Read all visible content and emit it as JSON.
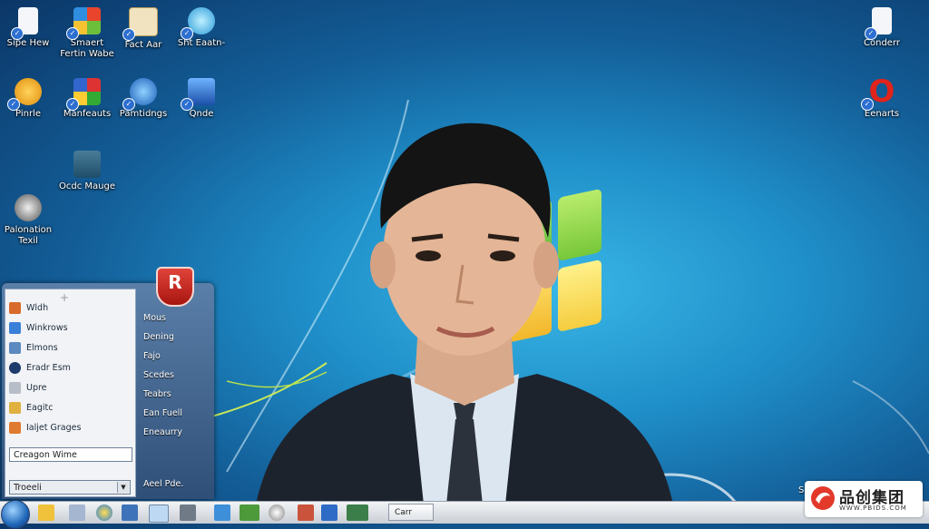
{
  "desktop": {
    "icons": [
      {
        "label": "Sipe Hew"
      },
      {
        "label": "Smaert Fertin Wabe"
      },
      {
        "label": "Fact Aar"
      },
      {
        "label": "Sht Eaatn-"
      },
      {
        "label": "Conderr"
      },
      {
        "label": "Pinrle"
      },
      {
        "label": "Manfeauts"
      },
      {
        "label": "Pamtidngs"
      },
      {
        "label": "Qnde"
      },
      {
        "label": "Eenarts"
      },
      {
        "label": "Ocdc Mauge"
      },
      {
        "label": "Palonation Texil"
      }
    ]
  },
  "start_menu": {
    "badge": "R",
    "left_items": [
      {
        "label": "Wldh"
      },
      {
        "label": "Winkrows"
      },
      {
        "label": "Elmons"
      },
      {
        "label": "Eradr Esm"
      },
      {
        "label": "Upre"
      },
      {
        "label": "Eagitc"
      },
      {
        "label": "Ialjet Grages"
      }
    ],
    "search_value": "Creagon Wime",
    "dropdown_value": "Troeeli",
    "right_items": [
      {
        "label": "Mous"
      },
      {
        "label": "Dening"
      },
      {
        "label": "Fajo"
      },
      {
        "label": "Scedes"
      },
      {
        "label": "Teabrs"
      },
      {
        "label": "Ean Fuell"
      },
      {
        "label": "Eneaurry"
      }
    ],
    "footer_label": "Aeel Pde."
  },
  "taskbar": {
    "button_label": "Carr",
    "tray_letter": "S"
  },
  "watermark": {
    "brand": "品创集团",
    "url": "WWW.PBIDS.COM"
  },
  "colors": {
    "desktop_blue": "#1f8fc9",
    "start_menu_frame": "#2f4f78",
    "taskbar": "#dfe3e8"
  }
}
